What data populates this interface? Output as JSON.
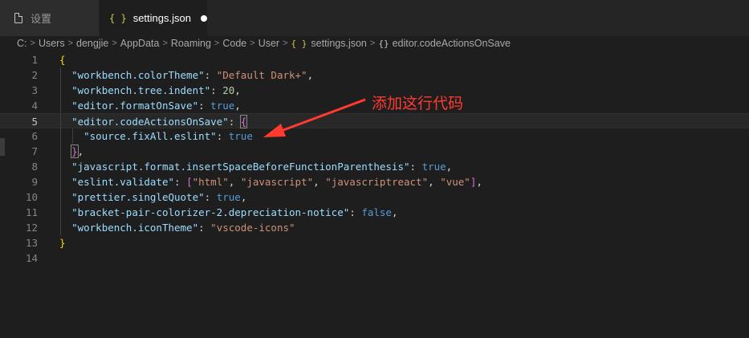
{
  "tabs": [
    {
      "label": "设置",
      "icon": "file-icon",
      "active": false
    },
    {
      "label": "settings.json",
      "icon": "json-braces-icon",
      "active": true,
      "dirty": true
    }
  ],
  "breadcrumb": [
    "C:",
    "Users",
    "dengjie",
    "AppData",
    "Roaming",
    "Code",
    "User",
    "settings.json",
    "editor.codeActionsOnSave"
  ],
  "annotation": "添加这行代码",
  "lines": [
    {
      "n": "1",
      "tokens": [
        {
          "t": "{",
          "c": "br"
        }
      ]
    },
    {
      "n": "2",
      "tokens": [
        {
          "t": "  "
        },
        {
          "t": "\"workbench.colorTheme\"",
          "c": "k"
        },
        {
          "t": ": "
        },
        {
          "t": "\"Default Dark+\"",
          "c": "s"
        },
        {
          "t": ","
        }
      ]
    },
    {
      "n": "3",
      "tokens": [
        {
          "t": "  "
        },
        {
          "t": "\"workbench.tree.indent\"",
          "c": "k"
        },
        {
          "t": ": "
        },
        {
          "t": "20",
          "c": "n"
        },
        {
          "t": ","
        }
      ]
    },
    {
      "n": "4",
      "tokens": [
        {
          "t": "  "
        },
        {
          "t": "\"editor.formatOnSave\"",
          "c": "k"
        },
        {
          "t": ": "
        },
        {
          "t": "true",
          "c": "b"
        },
        {
          "t": ","
        }
      ]
    },
    {
      "n": "5",
      "tokens": [
        {
          "t": "  "
        },
        {
          "t": "\"editor.codeActionsOnSave\"",
          "c": "k"
        },
        {
          "t": ": "
        },
        {
          "t": "{",
          "c": "br2 bracket-match"
        }
      ]
    },
    {
      "n": "6",
      "tokens": [
        {
          "t": "    "
        },
        {
          "t": "\"source.fixAll.eslint\"",
          "c": "k"
        },
        {
          "t": ": "
        },
        {
          "t": "true",
          "c": "b"
        }
      ]
    },
    {
      "n": "7",
      "tokens": [
        {
          "t": "  "
        },
        {
          "t": "}",
          "c": "br2 bracket-match"
        },
        {
          "t": ","
        }
      ]
    },
    {
      "n": "8",
      "tokens": [
        {
          "t": "  "
        },
        {
          "t": "\"javascript.format.insertSpaceBeforeFunctionParenthesis\"",
          "c": "k"
        },
        {
          "t": ": "
        },
        {
          "t": "true",
          "c": "b"
        },
        {
          "t": ","
        }
      ]
    },
    {
      "n": "9",
      "tokens": [
        {
          "t": "  "
        },
        {
          "t": "\"eslint.validate\"",
          "c": "k"
        },
        {
          "t": ": "
        },
        {
          "t": "[",
          "c": "br2"
        },
        {
          "t": "\"html\"",
          "c": "s"
        },
        {
          "t": ", "
        },
        {
          "t": "\"javascript\"",
          "c": "s"
        },
        {
          "t": ", "
        },
        {
          "t": "\"javascriptreact\"",
          "c": "s"
        },
        {
          "t": ", "
        },
        {
          "t": "\"vue\"",
          "c": "s"
        },
        {
          "t": "]",
          "c": "br2"
        },
        {
          "t": ","
        }
      ]
    },
    {
      "n": "10",
      "tokens": [
        {
          "t": "  "
        },
        {
          "t": "\"prettier.singleQuote\"",
          "c": "k"
        },
        {
          "t": ": "
        },
        {
          "t": "true",
          "c": "b"
        },
        {
          "t": ","
        }
      ]
    },
    {
      "n": "11",
      "tokens": [
        {
          "t": "  "
        },
        {
          "t": "\"bracket-pair-colorizer-2.depreciation-notice\"",
          "c": "k"
        },
        {
          "t": ": "
        },
        {
          "t": "false",
          "c": "b"
        },
        {
          "t": ","
        }
      ]
    },
    {
      "n": "12",
      "tokens": [
        {
          "t": "  "
        },
        {
          "t": "\"workbench.iconTheme\"",
          "c": "k"
        },
        {
          "t": ": "
        },
        {
          "t": "\"vscode-icons\"",
          "c": "s"
        }
      ]
    },
    {
      "n": "13",
      "tokens": [
        {
          "t": "}",
          "c": "br"
        }
      ]
    },
    {
      "n": "14",
      "tokens": []
    }
  ],
  "current_line": "5",
  "colors": {
    "annotation": "#ff3b30",
    "background": "#1e1e1e"
  }
}
